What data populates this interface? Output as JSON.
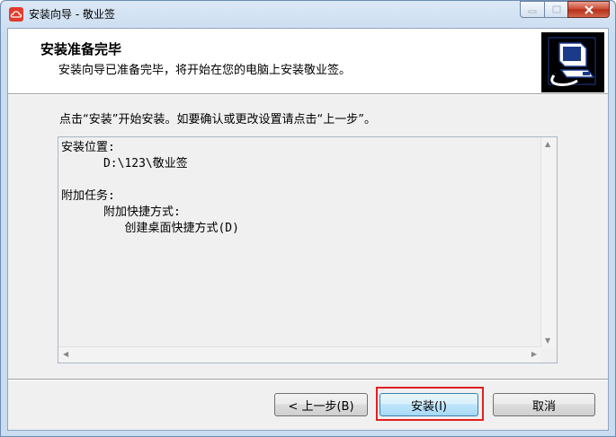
{
  "window": {
    "title": "安装向导 - 敬业签",
    "icon": "cloud-app-icon",
    "controls": [
      "minimize-icon",
      "maximize-icon",
      "close-icon"
    ]
  },
  "header": {
    "title": "安装准备完毕",
    "subtitle": "安装向导已准备完毕，将开始在您的电脑上安装敬业签。",
    "image": "computer-install-icon"
  },
  "instructions": "点击“安装”开始安装。如要确认或更改设置请点击“上一步”。",
  "summary": {
    "location_label": "安装位置:",
    "location_value": "      D:\\123\\敬业签",
    "tasks_label": "附加任务:",
    "tasks_group": "      附加快捷方式:",
    "tasks_item": "         创建桌面快捷方式(D)"
  },
  "buttons": {
    "back": "< 上一步(B)",
    "install": "安装(I)",
    "cancel": "取消"
  },
  "colors": {
    "highlight": "#e02020",
    "install_border": "#3c7fb1"
  }
}
